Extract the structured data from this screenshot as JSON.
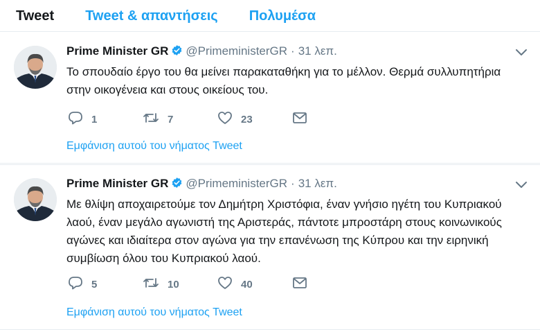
{
  "tabs": [
    {
      "label": "Tweet"
    },
    {
      "label": "Tweet & απαντήσεις"
    },
    {
      "label": "Πολυμέσα"
    }
  ],
  "tweets": [
    {
      "name": "Prime Minister GR",
      "handle": "@PrimeministerGR",
      "separator": "·",
      "time": "31 λεπ.",
      "text": "Το σπουδαίο έργο του θα μείνει παρακαταθήκη για το μέλλον. Θερμά συλλυπητήρια στην οικογένεια και στους οικείους του.",
      "replies": "1",
      "retweets": "7",
      "likes": "23",
      "show_thread": "Εμφάνιση αυτού του νήματος Tweet"
    },
    {
      "name": "Prime Minister GR",
      "handle": "@PrimeministerGR",
      "separator": "·",
      "time": "31 λεπ.",
      "text": "Με θλίψη αποχαιρετούμε τον Δημήτρη Χριστόφια, έναν γνήσιο ηγέτη του Κυπριακού λαού, έναν μεγάλο αγωνιστή της Αριστεράς, πάντοτε μπροστάρη στους κοινωνικούς αγώνες και ιδιαίτερα στον αγώνα για την επανένωση της Κύπρου και την ειρηνική συμβίωση όλου του Κυπριακού λαού.",
      "replies": "5",
      "retweets": "10",
      "likes": "40",
      "show_thread": "Εμφάνιση αυτού του νήματος Tweet"
    }
  ],
  "icons": {
    "verified": "verified-badge-icon",
    "caret": "chevron-down-icon",
    "reply": "reply-icon",
    "retweet": "retweet-icon",
    "like": "heart-icon",
    "message": "direct-message-icon"
  },
  "colors": {
    "accent": "#1da1f2",
    "muted": "#657786",
    "text": "#14171a",
    "border": "#e6ecf0"
  }
}
